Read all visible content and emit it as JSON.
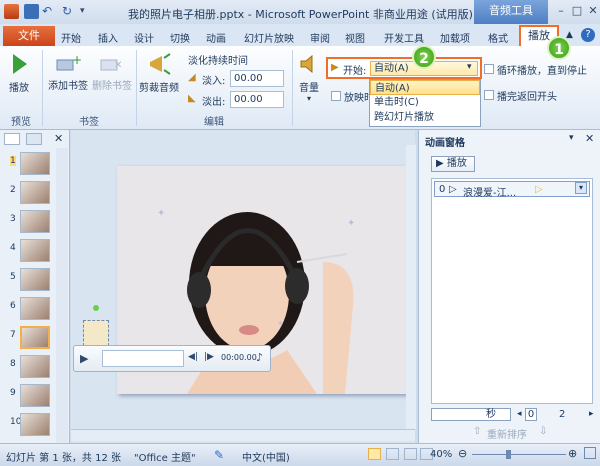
{
  "window": {
    "title": "我的照片电子相册.pptx - Microsoft PowerPoint 非商业用途 (试用版)",
    "context_group": "音频工具",
    "minimize": "–",
    "restore": "□",
    "close": "✕"
  },
  "tabs": [
    "开始",
    "插入",
    "设计",
    "切换",
    "动画",
    "幻灯片放映",
    "审阅",
    "视图",
    "开发工具",
    "加载项",
    "格式"
  ],
  "file_tab": "文件",
  "active_tab": "播放",
  "ribbon": {
    "play_label": "播放",
    "add_bookmark": "添加书签",
    "remove_bookmark": "删除书签",
    "trim_audio": "剪裁音频",
    "fade_duration": "淡化持续时间",
    "fade_in": "淡入:",
    "fade_out": "淡出:",
    "fade_in_value": "00.00",
    "fade_out_value": "00.00",
    "volume": "音量",
    "start_label": "开始:",
    "start_value": "自动(A)",
    "hide_during_show": "放映时",
    "loop_until_stopped": "循环播放，直到停止",
    "rewind_after_playing": "播完返回开头",
    "group_preview": "预览",
    "group_bookmarks": "书签",
    "group_edit": "编辑"
  },
  "dropdown": {
    "options": [
      "自动(A)",
      "单击时(C)",
      "跨幻灯片播放"
    ],
    "selected": 0
  },
  "badges": {
    "one": "1",
    "two": "2"
  },
  "slides": {
    "numbers": [
      "1",
      "2",
      "3",
      "4",
      "5",
      "6",
      "7",
      "8",
      "9",
      "10"
    ],
    "selected": "7"
  },
  "player": {
    "time": "00:00.00"
  },
  "anim_pane": {
    "title": "动画窗格",
    "play_button": "播放",
    "item_index": "0",
    "item_label": "浪漫爱-江...",
    "seconds_label": "秒",
    "timeline_start": "0",
    "timeline_end": "2",
    "reorder_label": "重新排序"
  },
  "status": {
    "slide_info": "幻灯片 第 1 张，共 12 张",
    "theme": "\"Office 主题\"",
    "language": "中文(中国)",
    "zoom": "40%"
  }
}
